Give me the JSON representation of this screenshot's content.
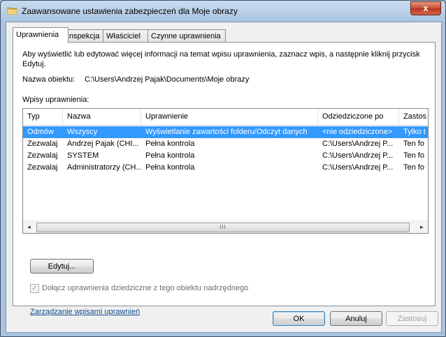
{
  "window": {
    "title": "Zaawansowane ustawienia zabezpieczeń dla Moje obrazy",
    "close_glyph": "x",
    "icon": "folder-icon"
  },
  "tabs": [
    {
      "label": "Uprawnienia",
      "active": true
    },
    {
      "label": "Inspekcja",
      "active": false
    },
    {
      "label": "Właściciel",
      "active": false
    },
    {
      "label": "Czynne uprawnienia",
      "active": false
    }
  ],
  "panel": {
    "description": "Aby wyświetlić lub edytować więcej informacji na temat wpisu uprawnienia, zaznacz wpis, a następnie kliknij przycisk Edytuj.",
    "object_name_label": "Nazwa obiektu:",
    "object_name_value": "C:\\Users\\Andrzej Pajak\\Documents\\Moje obrazy",
    "entries_label": "Wpisy uprawnienia:"
  },
  "permissions_table": {
    "columns": [
      "Typ",
      "Nazwa",
      "Uprawnienie",
      "Odziedziczone po",
      "Zastos"
    ],
    "rows": [
      {
        "type": "Odmów",
        "name": "Wszyscy",
        "permission": "Wyświetlanie zawartości folderu/Odczyt danych",
        "inherited_from": "<nie odziedziczone>",
        "applies_to": "Tylko t",
        "selected": true
      },
      {
        "type": "Zezwalaj",
        "name": "Andrzej Pajak (CHI...",
        "permission": "Pełna kontrola",
        "inherited_from": "C:\\Users\\Andrzej P...",
        "applies_to": "Ten fo",
        "selected": false
      },
      {
        "type": "Zezwalaj",
        "name": "SYSTEM",
        "permission": "Pełna kontrola",
        "inherited_from": "C:\\Users\\Andrzej P...",
        "applies_to": "Ten fo",
        "selected": false
      },
      {
        "type": "Zezwalaj",
        "name": "Administratorzy (CH...",
        "permission": "Pełna kontrola",
        "inherited_from": "C:\\Users\\Andrzej P...",
        "applies_to": "Ten fo",
        "selected": false
      }
    ],
    "scroll_left_glyph": "◄",
    "scroll_right_glyph": "►",
    "scroll_grip": "III"
  },
  "buttons": {
    "edit": "Edytuj...",
    "ok": "OK",
    "cancel": "Anuluj",
    "apply": "Zastosuj"
  },
  "inherit_checkbox": {
    "label": "Dołącz uprawnienia dziedziczne z tego obiektu nadrzędnego",
    "checked": true,
    "check_glyph": "✓",
    "disabled": true
  },
  "manage_link": "Zarządzanie wpisami uprawnień",
  "colors": {
    "selection": "#3399ff",
    "link": "#0f4a8c"
  }
}
